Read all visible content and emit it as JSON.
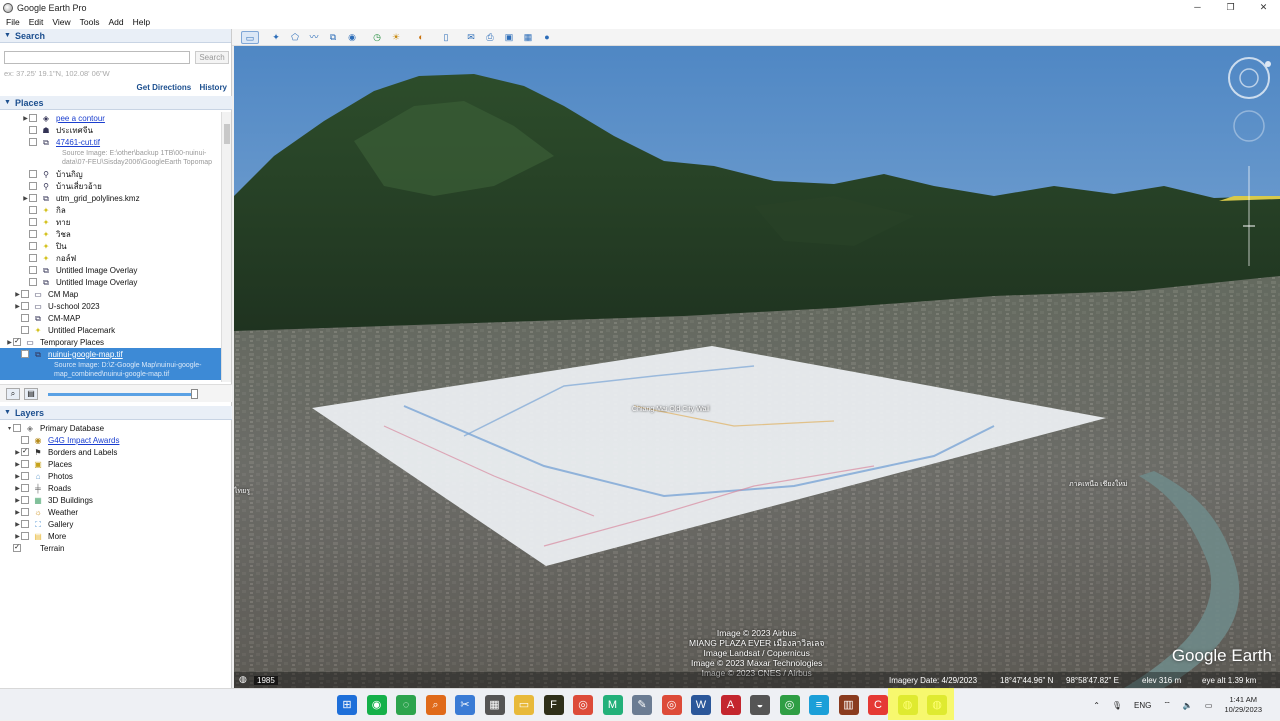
{
  "window": {
    "title": "Google Earth Pro",
    "controls": [
      "─",
      "❐",
      "✕"
    ]
  },
  "menu": [
    "File",
    "Edit",
    "View",
    "Tools",
    "Add",
    "Help"
  ],
  "search": {
    "header": "Search",
    "placeholder": "",
    "button": "Search",
    "hint": "ex: 37.25' 19.1\"N, 102.08' 06\"W",
    "links": [
      "Get Directions",
      "History"
    ]
  },
  "places": {
    "header": "Places",
    "items": [
      {
        "label": "pee a contour",
        "link": true,
        "indent": 1,
        "expander": true
      },
      {
        "label": "ประเทศจีน",
        "indent": 1
      },
      {
        "label": "47461-cut.tif",
        "link": true,
        "indent": 1
      },
      {
        "label": "Source Image: E:\\other\\backup 1TB\\00-nuinui-data\\07-FEU\\Sisday2006\\GoogleEarth Topomap",
        "sub": true,
        "indent": 1
      },
      {
        "label": "บ้านกิญ",
        "indent": 1
      },
      {
        "label": "บ้านเสี่ยวอ้าย",
        "indent": 1
      },
      {
        "label": "utm_grid_polylines.kmz",
        "indent": 1,
        "expander": true
      },
      {
        "label": "กิล",
        "indent": 1
      },
      {
        "label": "ทาย",
        "indent": 1
      },
      {
        "label": "วิชล",
        "indent": 1
      },
      {
        "label": "ปิน",
        "indent": 1
      },
      {
        "label": "กอล์ฟ",
        "indent": 1
      },
      {
        "label": "Untitled Image Overlay",
        "indent": 1
      },
      {
        "label": "Untitled Image Overlay",
        "indent": 1
      },
      {
        "label": "CM Map",
        "indent": 0,
        "expander": true
      },
      {
        "label": "U-school 2023",
        "indent": 0,
        "expander": true
      },
      {
        "label": "CM-MAP",
        "indent": 0
      },
      {
        "label": "Untitled Placemark",
        "indent": 0
      },
      {
        "label": "Temporary Places",
        "indent": -1,
        "expander": true,
        "checked": true
      },
      {
        "label": "nuinui-google-map.tif",
        "link": true,
        "indent": 0,
        "selected": true,
        "checked": true
      },
      {
        "label": "Source Image: D:\\Z-Google Map\\nuinui-google-map_combined\\nuinui-google-map.tif",
        "sub": true,
        "selected": true,
        "indent": 0
      }
    ]
  },
  "layers": {
    "header": "Layers",
    "items": [
      {
        "label": "Primary Database",
        "indent": -1
      },
      {
        "label": "G4G Impact Awards",
        "link": true
      },
      {
        "label": "Borders and Labels",
        "checked": true
      },
      {
        "label": "Places"
      },
      {
        "label": "Photos"
      },
      {
        "label": "Roads"
      },
      {
        "label": "3D Buildings"
      },
      {
        "label": "Weather"
      },
      {
        "label": "Gallery"
      },
      {
        "label": "More"
      },
      {
        "label": "Terrain",
        "checked": true,
        "indent": -1
      }
    ]
  },
  "viewer": {
    "attribution": [
      "Image © 2023 Airbus",
      "MIANG PLAZA EVER เมืองลาวิลเลจ",
      "Image Landsat / Copernicus",
      "Image © 2023 Maxar Technologies",
      "Image © 2023 CNES / Airbus"
    ],
    "brand": "Google Earth",
    "overlay_label": "Chiang Mai Old City Wall",
    "river_label": "ภาคเหนือ เชียงใหม่",
    "left_label": "ไทยรู",
    "status": {
      "year": "1985",
      "imagery_date": "Imagery Date: 4/29/2023",
      "lat": "18°47'44.96\" N",
      "lon": "98°58'47.82\" E",
      "elev": "elev  316 m",
      "eye_alt": "eye alt  1.39 km"
    }
  },
  "taskbar": {
    "tray": {
      "lang": "ENG",
      "time": "1:41 AM",
      "date": "10/29/2023"
    }
  },
  "colors": {
    "selection": "#3d8ad6",
    "section_header": "#1c4f8f",
    "link": "#1a3ecf"
  }
}
